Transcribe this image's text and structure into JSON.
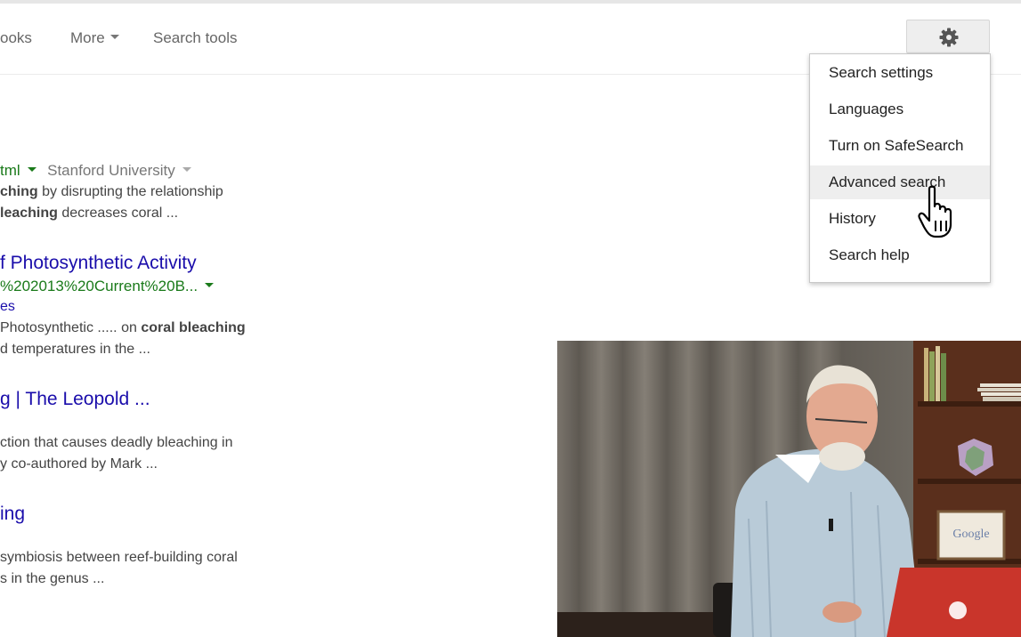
{
  "toolbar": {
    "books_label": "ooks",
    "more_label": "More",
    "search_tools_label": "Search tools"
  },
  "settings_menu": {
    "items": [
      {
        "label": "Search settings"
      },
      {
        "label": "Languages"
      },
      {
        "label": "Turn on SafeSearch"
      },
      {
        "label": "Advanced search"
      },
      {
        "label": "History"
      },
      {
        "label": "Search help"
      }
    ],
    "hovered_item": "Advanced search"
  },
  "results": [
    {
      "url": "tml",
      "source": "Stanford University",
      "snippet_line1_bold": "ching",
      "snippet_line1_rest": " by disrupting the relationship",
      "snippet_line2_bold": "leaching",
      "snippet_line2_rest": " decreases coral ..."
    },
    {
      "title": "f Photosynthetic Activity",
      "url": "%202013%20Current%20B...",
      "extra_link": "es",
      "snippet_line1_a": "Photosynthetic ..... on ",
      "snippet_line1_bold": "coral bleaching",
      "snippet_line2": "d temperatures in the ..."
    },
    {
      "title": "g | The Leopold ...",
      "snippet_line1": "ction that causes deadly bleaching in",
      "snippet_line2": "y co-authored by Mark ..."
    },
    {
      "title": "ing",
      "snippet_line1": "symbiosis between reef-building coral",
      "snippet_line2": "s in the genus ..."
    }
  ],
  "video_overlay": {
    "sign_text": "Google"
  },
  "colors": {
    "link": "#1a0dab",
    "url_green": "#1a7a1a",
    "menu_hover": "#eeeeee"
  }
}
